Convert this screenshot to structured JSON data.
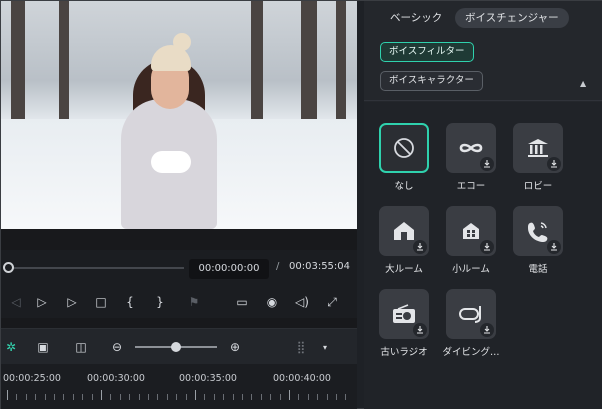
{
  "player": {
    "current_time": "00:00:00:00",
    "separator": "/",
    "total_time": "00:03:55:04",
    "progress": 0
  },
  "controls": [
    {
      "name": "prev-frame-icon",
      "glyph": "◁",
      "dim": true
    },
    {
      "name": "step-play-icon",
      "glyph": "▷",
      "dim": false
    },
    {
      "name": "play-icon",
      "glyph": "▷",
      "dim": false
    },
    {
      "name": "stop-icon",
      "glyph": "□",
      "dim": false
    },
    {
      "name": "mark-in-icon",
      "glyph": "{",
      "dim": false
    },
    {
      "name": "mark-out-icon",
      "glyph": "}",
      "dim": false
    },
    {
      "name": "marker-icon",
      "glyph": "⚑",
      "dim": true
    },
    {
      "name": "display-icon",
      "glyph": "▭",
      "dim": false
    },
    {
      "name": "snapshot-icon",
      "glyph": "◉",
      "dim": false
    },
    {
      "name": "volume-icon",
      "glyph": "◁)",
      "dim": false
    },
    {
      "name": "fullscreen-icon",
      "glyph": "⤢",
      "dim": false
    }
  ],
  "timeline": {
    "zoom_level": 0.45,
    "labels": [
      "00:00:25:00",
      "00:00:30:00",
      "00:00:35:00",
      "00:00:40:00"
    ]
  },
  "panel": {
    "tabs": [
      "ベーシック",
      "ボイスチェンジャー"
    ],
    "active_tab": "ボイスチェンジャー",
    "filter_buttons": [
      "ボイスフィルター",
      "ボイスキャラクター"
    ],
    "selected_filter": "ボイスフィルター",
    "collapse_glyph": "▲",
    "presets": [
      {
        "label": "なし",
        "icon": "none-icon",
        "selected": true
      },
      {
        "label": "エコー",
        "icon": "echo-icon",
        "selected": false
      },
      {
        "label": "ロビー",
        "icon": "lobby-icon",
        "selected": false
      },
      {
        "label": "大ルーム",
        "icon": "large-room-icon",
        "selected": false
      },
      {
        "label": "小ルーム",
        "icon": "small-room-icon",
        "selected": false
      },
      {
        "label": "電話",
        "icon": "phone-icon",
        "selected": false
      },
      {
        "label": "古いラジオ",
        "icon": "radio-icon",
        "selected": false
      },
      {
        "label": "ダイビング…",
        "icon": "diving-icon",
        "selected": false
      }
    ]
  },
  "colors": {
    "accent": "#2fd1ad",
    "panel_bg": "#24272c",
    "tile_bg": "#3a3d43"
  }
}
